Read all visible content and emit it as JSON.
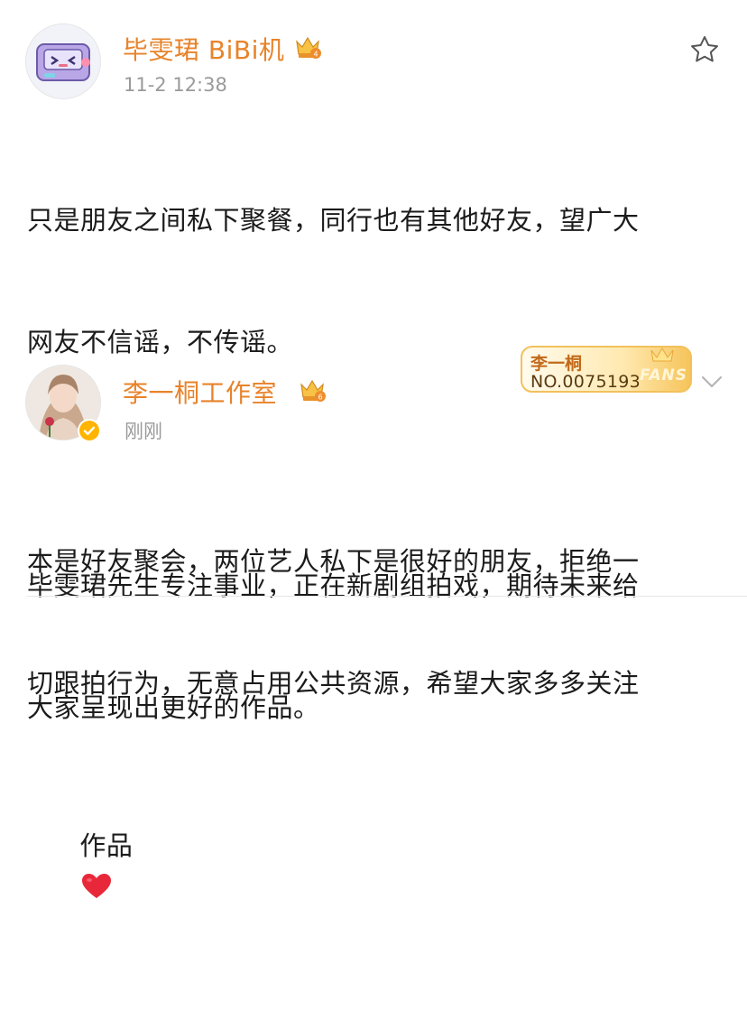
{
  "post1": {
    "author": "毕雯珺 BiBi机",
    "time": "11-2 12:38",
    "lines": [
      "只是朋友之间私下聚餐，同行也有其他好友，望广大",
      "网友不信谣，不传谣。",
      "",
      "毕雯珺先生专注事业，正在新剧组拍戏，期待未来给",
      "大家呈现出更好的作品。"
    ],
    "crown_level": "4"
  },
  "post2": {
    "author": "李一桐工作室",
    "time": "刚刚",
    "crown_level": "6",
    "fans_badge": {
      "name": "李一桐",
      "number": "NO.0075193",
      "tag": "FANS"
    },
    "lines": [
      "本是好友聚会，两位艺人私下是很好的朋友，拒绝一",
      "切跟拍行为，无意占用公共资源，希望大家多多关注",
      "作品"
    ],
    "emoji": "heart-emoji"
  },
  "colors": {
    "name": "#e8832a",
    "time": "#9a9a9a",
    "text": "#1b1b1b",
    "verified": "#ffb400"
  }
}
